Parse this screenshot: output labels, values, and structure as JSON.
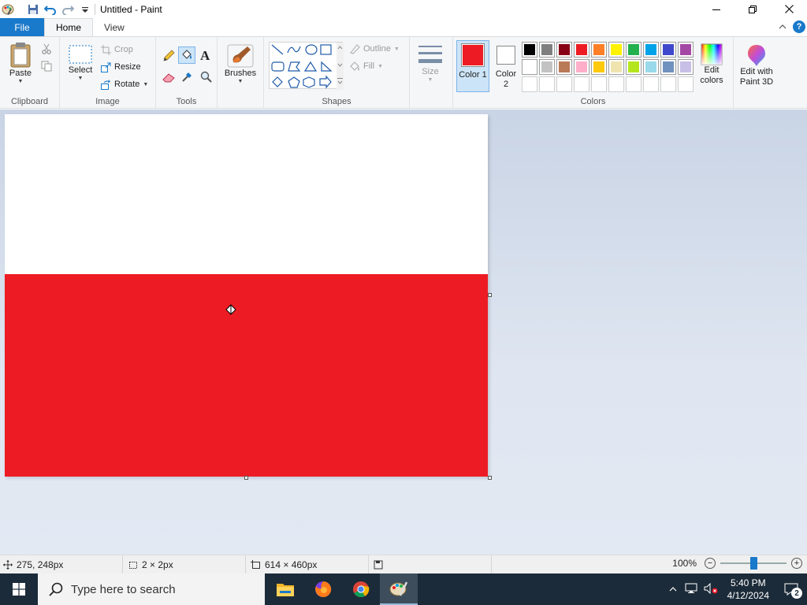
{
  "window": {
    "title": "Untitled - Paint"
  },
  "tabs": {
    "file": "File",
    "home": "Home",
    "view": "View"
  },
  "ribbon": {
    "clipboard": {
      "label": "Clipboard",
      "paste": "Paste"
    },
    "image": {
      "label": "Image",
      "select": "Select",
      "crop": "Crop",
      "resize": "Resize",
      "rotate": "Rotate"
    },
    "tools": {
      "label": "Tools"
    },
    "brushes": {
      "label": "Brushes"
    },
    "shapes": {
      "label": "Shapes",
      "outline": "Outline",
      "fill": "Fill"
    },
    "size": {
      "label": "Size"
    },
    "colors": {
      "label": "Colors",
      "color1": "Color 1",
      "color2": "Color 2",
      "edit": "Edit colors",
      "paint3d": "Edit with Paint 3D",
      "color1_value": "#ed1c24",
      "color2_value": "#ffffff",
      "palette": [
        "#000000",
        "#7f7f7f",
        "#880015",
        "#ed1c24",
        "#ff7f27",
        "#fff200",
        "#22b14c",
        "#00a2e8",
        "#3f48cc",
        "#a349a4",
        "#ffffff",
        "#c3c3c3",
        "#b97a57",
        "#ffaec9",
        "#ffc90e",
        "#efe4b0",
        "#b5e61d",
        "#99d9ea",
        "#7092be",
        "#c8bfe7"
      ]
    }
  },
  "canvas": {
    "top_color": "#ffffff",
    "bottom_color": "#ed1c24"
  },
  "status": {
    "cursor_pos": "275, 248px",
    "selection_size": "2 × 2px",
    "canvas_size": "614 × 460px",
    "zoom": "100%"
  },
  "taskbar": {
    "search_placeholder": "Type here to search",
    "time": "5:40 PM",
    "date": "4/12/2024",
    "notifications": "2"
  }
}
